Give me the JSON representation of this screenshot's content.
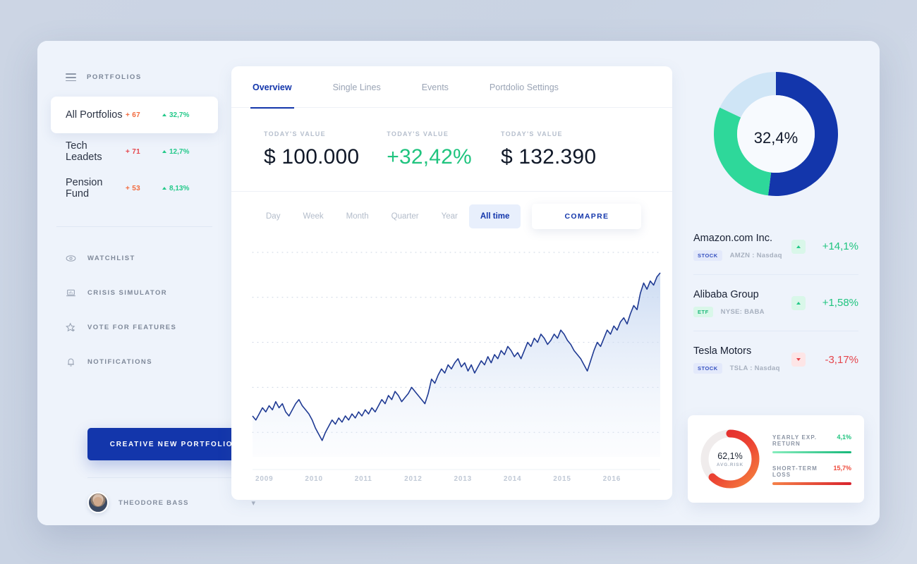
{
  "sidebar": {
    "menu_icon": "hamburger-icon",
    "header_label": "PORTFOLIOS",
    "portfolios": [
      {
        "name": "All Portfolios",
        "count": "+ 67",
        "pct": "32,7%",
        "active": true
      },
      {
        "name": "Tech Leadets",
        "count": "+ 71",
        "pct": "12,7%",
        "active": false
      },
      {
        "name": "Pension Fund",
        "count": "+ 53",
        "pct": "8,13%",
        "active": false
      }
    ],
    "nav": [
      {
        "label": "WATCHLIST",
        "icon": "eye-icon"
      },
      {
        "label": "CRISIS SIMULATOR",
        "icon": "laptop-icon"
      },
      {
        "label": "VOTE FOR FEATURES",
        "icon": "star-plus-icon"
      },
      {
        "label": "NOTIFICATIONS",
        "icon": "bell-icon"
      }
    ],
    "cta_label": "CREATIVE NEW PORTFOLIO",
    "user_name": "THEODORE BASS",
    "user_chevron": "▾"
  },
  "main": {
    "tabs": [
      {
        "label": "Overview",
        "active": true
      },
      {
        "label": "Single Lines",
        "active": false
      },
      {
        "label": "Events",
        "active": false
      },
      {
        "label": "Portdolio Settings",
        "active": false
      }
    ],
    "stats": [
      {
        "label": "TODAY'S VALUE",
        "value": "$ 100.000",
        "color": "dark"
      },
      {
        "label": "TODAY'S VALUE",
        "value": "+32,42%",
        "color": "green"
      },
      {
        "label": "TODAY'S VALUE",
        "value": "$ 132.390",
        "color": "dark"
      }
    ],
    "ranges": [
      {
        "label": "Day",
        "active": false
      },
      {
        "label": "Week",
        "active": false
      },
      {
        "label": "Month",
        "active": false
      },
      {
        "label": "Quarter",
        "active": false
      },
      {
        "label": "Year",
        "active": false
      },
      {
        "label": "All time",
        "active": true
      }
    ],
    "compare_label": "COMAPRE"
  },
  "chart_data": {
    "type": "line",
    "title": "",
    "xlabel": "",
    "ylabel": "",
    "grid": true,
    "legend": "none",
    "line_color": "#1f3a93",
    "fill_color": "#dce6f7",
    "categories": [
      "2009",
      "2010",
      "2011",
      "2012",
      "2013",
      "2014",
      "2015",
      "2016"
    ],
    "xlim": [
      2008.6,
      2016.6
    ],
    "ylim": [
      0,
      100
    ],
    "gridlines_y": [
      12,
      34,
      56,
      78,
      100
    ],
    "x": [
      0,
      1,
      2,
      3,
      4,
      5,
      6,
      7,
      8,
      9,
      10,
      11,
      12,
      13,
      14,
      15,
      16,
      17,
      18,
      19,
      20,
      21,
      22,
      23,
      24,
      25,
      26,
      27,
      28,
      29,
      30,
      31,
      32,
      33,
      34,
      35,
      36,
      37,
      38,
      39,
      40,
      41,
      42,
      43,
      44,
      45,
      46,
      47,
      48,
      49,
      50,
      51,
      52,
      53,
      54,
      55,
      56,
      57,
      58,
      59,
      60,
      61,
      62,
      63,
      64,
      65,
      66,
      67,
      68,
      69,
      70,
      71,
      72,
      73,
      74,
      75,
      76,
      77,
      78,
      79,
      80,
      81,
      82,
      83,
      84,
      85,
      86,
      87,
      88,
      89,
      90,
      91,
      92,
      93,
      94,
      95,
      96,
      97,
      98,
      99,
      100,
      101,
      102,
      103,
      104,
      105,
      106,
      107,
      108,
      109,
      110,
      111,
      112,
      113,
      114,
      115,
      116,
      117,
      118,
      119
    ],
    "values": [
      20,
      18,
      21,
      24,
      22,
      25,
      23,
      27,
      24,
      26,
      22,
      20,
      23,
      26,
      28,
      25,
      23,
      21,
      18,
      14,
      11,
      8,
      12,
      15,
      18,
      16,
      19,
      17,
      20,
      18,
      21,
      19,
      22,
      20,
      23,
      21,
      24,
      22,
      25,
      28,
      26,
      30,
      28,
      32,
      30,
      27,
      29,
      31,
      34,
      32,
      30,
      28,
      26,
      31,
      38,
      36,
      40,
      43,
      41,
      45,
      43,
      46,
      48,
      44,
      46,
      42,
      45,
      41,
      44,
      47,
      45,
      49,
      46,
      50,
      48,
      52,
      50,
      54,
      52,
      49,
      51,
      48,
      52,
      56,
      54,
      58,
      56,
      60,
      58,
      55,
      57,
      60,
      58,
      62,
      60,
      57,
      55,
      52,
      50,
      48,
      45,
      42,
      47,
      52,
      56,
      54,
      58,
      62,
      60,
      64,
      62,
      66,
      68,
      65,
      70,
      74,
      72,
      80,
      85,
      82,
      86,
      84,
      88,
      90
    ]
  },
  "donut": {
    "center_label": "32,4%",
    "segments": [
      {
        "name": "blue-segment",
        "value": 52,
        "color": "#1336ab"
      },
      {
        "name": "green-segment",
        "value": 30,
        "color": "#2ed89a"
      },
      {
        "name": "lightblue-segment",
        "value": 18,
        "color": "#cfe5f6"
      }
    ]
  },
  "stocks": [
    {
      "name": "Amazon.com Inc.",
      "badge": "STOCK",
      "badge_type": "stock",
      "ticker": "AMZN : Nasdaq",
      "pct": "+14,1%",
      "dir": "up"
    },
    {
      "name": "Alibaba Group",
      "badge": "ETF",
      "badge_type": "etf",
      "ticker": "NYSE: BABA",
      "pct": "+1,58%",
      "dir": "up"
    },
    {
      "name": "Tesla Motors",
      "badge": "STOCK",
      "badge_type": "stock",
      "ticker": "TSLA : Nasdaq",
      "pct": "-3,17%",
      "dir": "down"
    }
  ],
  "risk_card": {
    "donut_value": "62,1%",
    "donut_sub": "AVG.RISK",
    "donut_pct_number": 62.1,
    "legend": [
      {
        "name": "YEARLY EXP. RETURN",
        "value": "4,1%",
        "tone": "green"
      },
      {
        "name": "SHORT-TERM LOSS",
        "value": "15,7%",
        "tone": "red"
      }
    ]
  }
}
